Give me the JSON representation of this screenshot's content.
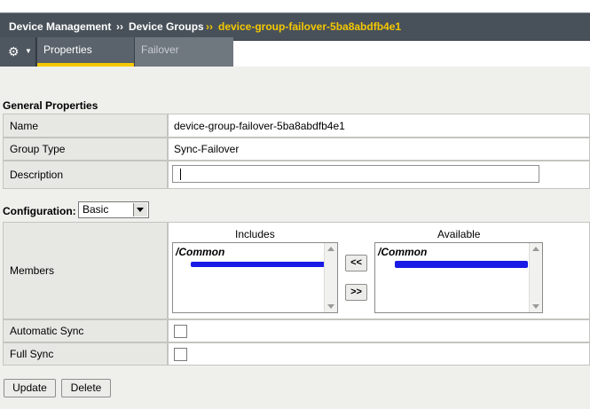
{
  "breadcrumb": {
    "items": [
      "Device Management",
      "Device Groups",
      "device-group-failover-5ba8abdfb4e1"
    ],
    "separator": "››"
  },
  "tabs": {
    "menu_icon": "gear-icon",
    "active": "Properties",
    "items": [
      "Properties",
      "Failover"
    ]
  },
  "general": {
    "section_title": "General Properties",
    "name_label": "Name",
    "name_value": "device-group-failover-5ba8abdfb4e1",
    "group_type_label": "Group Type",
    "group_type_value": "Sync-Failover",
    "description_label": "Description",
    "description_value": ""
  },
  "configuration": {
    "label": "Configuration:",
    "selected": "Basic"
  },
  "members": {
    "label": "Members",
    "includes_label": "Includes",
    "available_label": "Available",
    "includes_partition": "/Common",
    "available_partition": "/Common",
    "move_left": "<<",
    "move_right": ">>"
  },
  "options": {
    "automatic_sync_label": "Automatic Sync",
    "automatic_sync_checked": false,
    "full_sync_label": "Full Sync",
    "full_sync_checked": false
  },
  "actions": {
    "update": "Update",
    "delete": "Delete"
  },
  "colors": {
    "accent": "#f5c800",
    "header_bg": "#48515a",
    "redaction": "#1a1ae6"
  }
}
